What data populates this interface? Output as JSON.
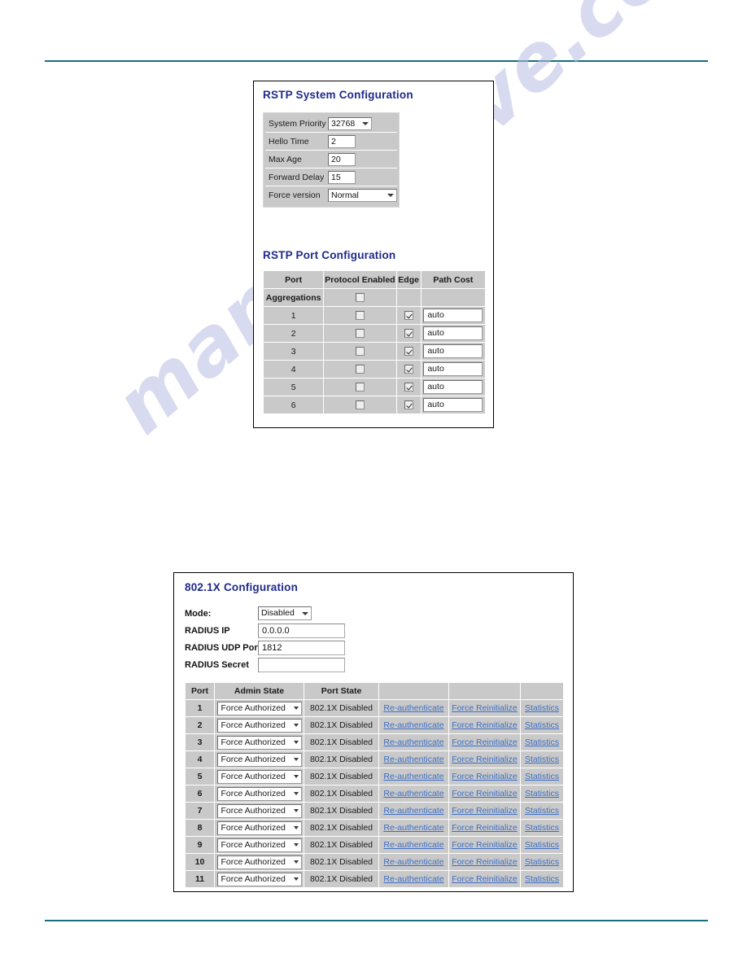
{
  "page": {
    "rule_color": "#15707f",
    "watermark_text": "manualshive.com"
  },
  "rstp": {
    "system": {
      "title": "RSTP System Configuration",
      "fields": [
        {
          "label": "System Priority",
          "value": "32768",
          "type": "select"
        },
        {
          "label": "Hello Time",
          "value": "2",
          "type": "text"
        },
        {
          "label": "Max Age",
          "value": "20",
          "type": "text"
        },
        {
          "label": "Forward Delay",
          "value": "15",
          "type": "text"
        },
        {
          "label": "Force version",
          "value": "Normal",
          "type": "select"
        }
      ]
    },
    "ports": {
      "title": "RSTP Port Configuration",
      "columns": [
        "Port",
        "Protocol Enabled",
        "Edge",
        "Path Cost"
      ],
      "rows": [
        {
          "port": "Aggregations",
          "protocol_enabled": false,
          "edge": null,
          "path_cost": null
        },
        {
          "port": "1",
          "protocol_enabled": false,
          "edge": true,
          "path_cost": "auto"
        },
        {
          "port": "2",
          "protocol_enabled": false,
          "edge": true,
          "path_cost": "auto"
        },
        {
          "port": "3",
          "protocol_enabled": false,
          "edge": true,
          "path_cost": "auto"
        },
        {
          "port": "4",
          "protocol_enabled": false,
          "edge": true,
          "path_cost": "auto"
        },
        {
          "port": "5",
          "protocol_enabled": false,
          "edge": true,
          "path_cost": "auto"
        },
        {
          "port": "6",
          "protocol_enabled": false,
          "edge": true,
          "path_cost": "auto"
        }
      ]
    }
  },
  "dot1x": {
    "title": "802.1X Configuration",
    "fields": [
      {
        "label": "Mode:",
        "value": "Disabled",
        "type": "select"
      },
      {
        "label": "RADIUS IP",
        "value": "0.0.0.0",
        "type": "text"
      },
      {
        "label": "RADIUS UDP Port",
        "value": "1812",
        "type": "text"
      },
      {
        "label": "RADIUS Secret",
        "value": "",
        "type": "text"
      }
    ],
    "table": {
      "columns": [
        "Port",
        "Admin State",
        "Port State",
        "",
        "",
        ""
      ],
      "link_labels": {
        "reauthenticate": "Re-authenticate",
        "force_reinitialize": "Force Reinitialize",
        "statistics": "Statistics"
      },
      "rows": [
        {
          "port": "1",
          "admin_state": "Force Authorized",
          "port_state": "802.1X Disabled"
        },
        {
          "port": "2",
          "admin_state": "Force Authorized",
          "port_state": "802.1X Disabled"
        },
        {
          "port": "3",
          "admin_state": "Force Authorized",
          "port_state": "802.1X Disabled"
        },
        {
          "port": "4",
          "admin_state": "Force Authorized",
          "port_state": "802.1X Disabled"
        },
        {
          "port": "5",
          "admin_state": "Force Authorized",
          "port_state": "802.1X Disabled"
        },
        {
          "port": "6",
          "admin_state": "Force Authorized",
          "port_state": "802.1X Disabled"
        },
        {
          "port": "7",
          "admin_state": "Force Authorized",
          "port_state": "802.1X Disabled"
        },
        {
          "port": "8",
          "admin_state": "Force Authorized",
          "port_state": "802.1X Disabled"
        },
        {
          "port": "9",
          "admin_state": "Force Authorized",
          "port_state": "802.1X Disabled"
        },
        {
          "port": "10",
          "admin_state": "Force Authorized",
          "port_state": "802.1X Disabled"
        },
        {
          "port": "11",
          "admin_state": "Force Authorized",
          "port_state": "802.1X Disabled"
        }
      ]
    }
  }
}
